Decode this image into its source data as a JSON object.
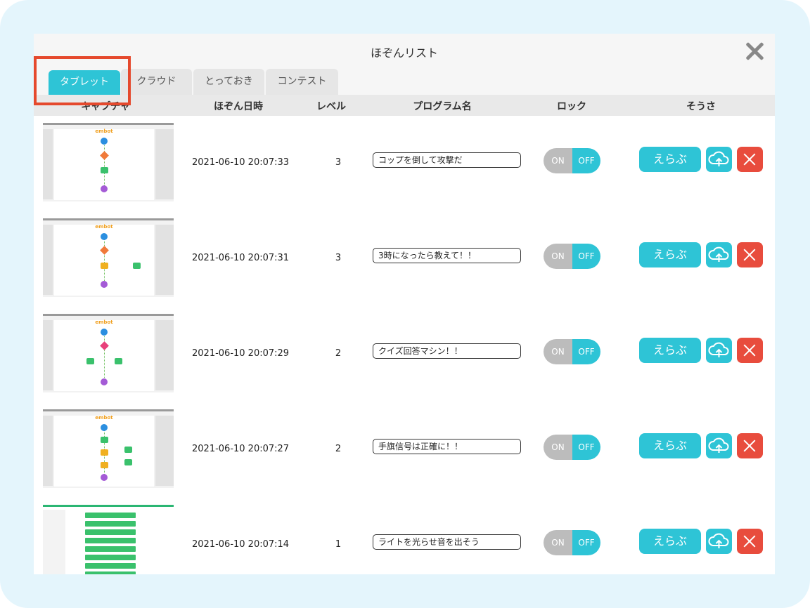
{
  "dialog": {
    "title": "ほぞんリスト",
    "close_icon": "close-icon"
  },
  "tabs": [
    {
      "label": "タブレット",
      "active": true
    },
    {
      "label": "クラウド",
      "active": false
    },
    {
      "label": "とっておき",
      "active": false
    },
    {
      "label": "コンテスト",
      "active": false
    }
  ],
  "columns": {
    "capture": "キャプチャ",
    "date": "ほぞん日時",
    "level": "レベル",
    "name": "プログラム名",
    "lock": "ロック",
    "ops": "そうさ"
  },
  "thumbnail": {
    "brand": "embot"
  },
  "buttons": {
    "select": "えらぶ",
    "on": "ON",
    "off": "OFF"
  },
  "rows": [
    {
      "date": "2021-06-10 20:07:33",
      "level": "3",
      "name": "コップを倒して攻撃だ"
    },
    {
      "date": "2021-06-10 20:07:31",
      "level": "3",
      "name": "3時になったら教えて！！"
    },
    {
      "date": "2021-06-10 20:07:29",
      "level": "2",
      "name": "クイズ回答マシン！！"
    },
    {
      "date": "2021-06-10 20:07:27",
      "level": "2",
      "name": "手旗信号は正確に！！"
    },
    {
      "date": "2021-06-10 20:07:14",
      "level": "1",
      "name": "ライトを光らせ音を出そう"
    }
  ],
  "colors": {
    "accent": "#2ec4d6",
    "danger": "#e84c3d",
    "highlight": "#e5492d",
    "off_gray": "#bcbcbc"
  }
}
